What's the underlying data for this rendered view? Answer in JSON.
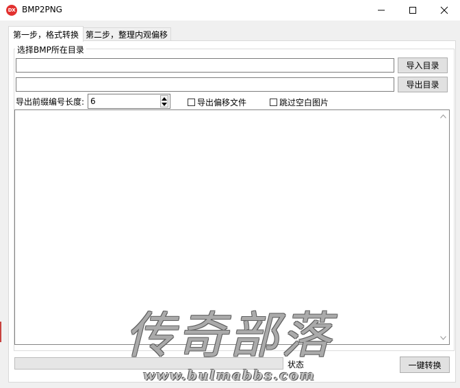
{
  "window": {
    "title": "BMP2PNG",
    "icon_text": "DX",
    "icon_color": "#e2312f"
  },
  "tabs": [
    {
      "label": "第一步，格式转换",
      "active": true
    },
    {
      "label": "第二步，整理内观偏移",
      "active": false
    }
  ],
  "group": {
    "label": "选择BMP所在目录"
  },
  "inputs": {
    "import_dir_value": "",
    "export_dir_value": ""
  },
  "buttons": {
    "import_dir": "导入目录",
    "export_dir": "导出目录",
    "convert": "一键转换"
  },
  "prefix_length": {
    "label": "导出前缀编号长度:",
    "value": "6"
  },
  "checkboxes": [
    {
      "label": "导出偏移文件",
      "checked": false
    },
    {
      "label": "跳过空白图片",
      "checked": false
    }
  ],
  "status": {
    "label": "状态",
    "progress": 0
  },
  "watermark": {
    "text": "传奇部落",
    "url": "www.bulmabbs.com"
  },
  "colors": {
    "progress_fill": "#06b025"
  }
}
